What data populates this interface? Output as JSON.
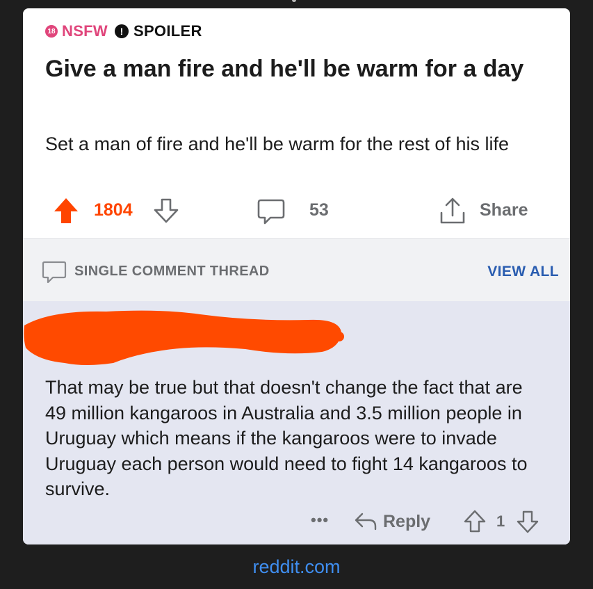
{
  "post": {
    "nsfw_badge": "18",
    "nsfw_label": "NSFW",
    "spoiler_symbol": "!",
    "spoiler_label": "SPOILER",
    "title": "Give a man fire and he'll be warm for a day",
    "body": "Set a man of fire and he'll be warm for the rest of his life",
    "score": "1804",
    "comments_count": "53",
    "share_label": "Share"
  },
  "thread": {
    "label": "SINGLE COMMENT THREAD",
    "view_all": "VIEW ALL"
  },
  "comment": {
    "text": "That may be true but that doesn't change the fact that are 49 million kangaroos in Australia and 3.5 million people in Uruguay which means if the kangaroos were to invade Uruguay each person would need to fight 14 kangaroos to survive.",
    "more": "•••",
    "reply_label": "Reply",
    "score": "1"
  },
  "footer": {
    "source": "reddit.com"
  },
  "colors": {
    "accent_upvote": "#ff4500",
    "nsfw": "#e0457b",
    "link": "#2a5db0",
    "footer_link": "#3f8ef0",
    "redaction": "#ff4a00"
  },
  "icons": [
    "upvote-arrow-icon",
    "downvote-arrow-icon",
    "comment-bubble-icon",
    "share-icon",
    "reply-arrow-icon"
  ]
}
